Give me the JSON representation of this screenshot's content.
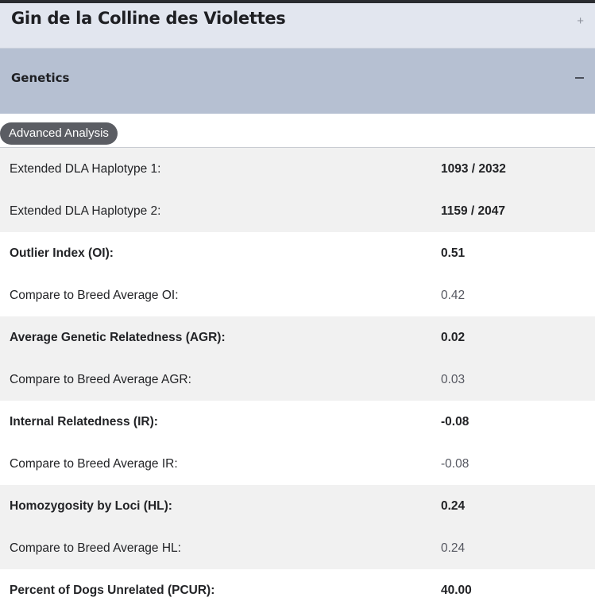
{
  "dog": {
    "name": "Gin de la Colline des Violettes",
    "expand_icon": "+"
  },
  "section": {
    "title": "Genetics",
    "collapse_icon": "minus"
  },
  "badge": {
    "label": "Advanced Analysis"
  },
  "rows": [
    {
      "label": "Extended DLA Haplotype 1:",
      "value": "1093 / 2032"
    },
    {
      "label": "Extended DLA Haplotype 2:",
      "value": "1159 / 2047"
    },
    {
      "label": "Outlier Index (OI):",
      "value": "0.51"
    },
    {
      "label": "Compare to Breed Average OI:",
      "value": "0.42"
    },
    {
      "label": "Average Genetic Relatedness (AGR):",
      "value": "0.02"
    },
    {
      "label": "Compare to Breed Average AGR:",
      "value": "0.03"
    },
    {
      "label": "Internal Relatedness (IR):",
      "value": "-0.08"
    },
    {
      "label": "Compare to Breed Average IR:",
      "value": "-0.08"
    },
    {
      "label": "Homozygosity by Loci (HL):",
      "value": "0.24"
    },
    {
      "label": "Compare to Breed Average HL:",
      "value": "0.24"
    },
    {
      "label": "Percent of Dogs Unrelated (PCUR):",
      "value": "40.00"
    }
  ]
}
